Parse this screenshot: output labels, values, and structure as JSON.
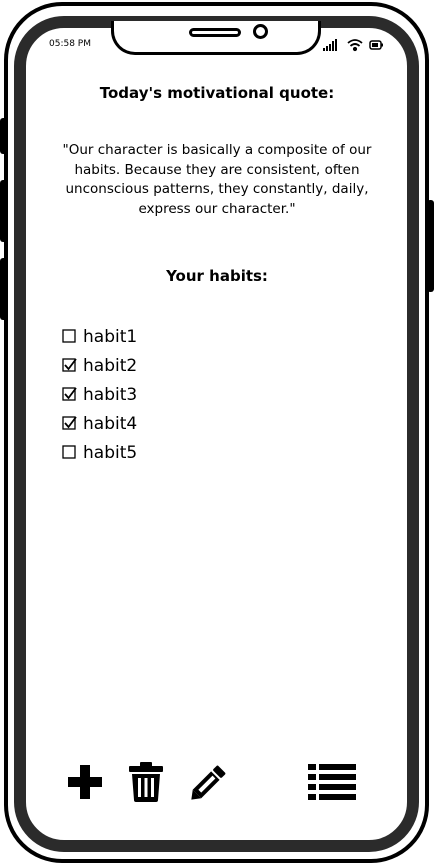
{
  "status_bar": {
    "time": "05:58 PM",
    "icons": [
      "signal-icon",
      "wifi-icon",
      "battery-icon"
    ]
  },
  "quote_section": {
    "heading": "Today's motivational quote:",
    "quote": "\"Our character is basically a composite of our habits. Because they are consistent, often unconscious patterns, they constantly, daily, express our character.\""
  },
  "habits_section": {
    "heading": "Your habits:",
    "items": [
      {
        "label": "habit1",
        "checked": false
      },
      {
        "label": "habit2",
        "checked": true
      },
      {
        "label": "habit3",
        "checked": true
      },
      {
        "label": "habit4",
        "checked": true
      },
      {
        "label": "habit5",
        "checked": false
      }
    ]
  },
  "toolbar": {
    "buttons": [
      {
        "icon": "plus-icon",
        "action": "add"
      },
      {
        "icon": "trash-icon",
        "action": "delete"
      },
      {
        "icon": "pencil-icon",
        "action": "edit"
      },
      {
        "icon": "list-icon",
        "action": "list"
      }
    ]
  }
}
